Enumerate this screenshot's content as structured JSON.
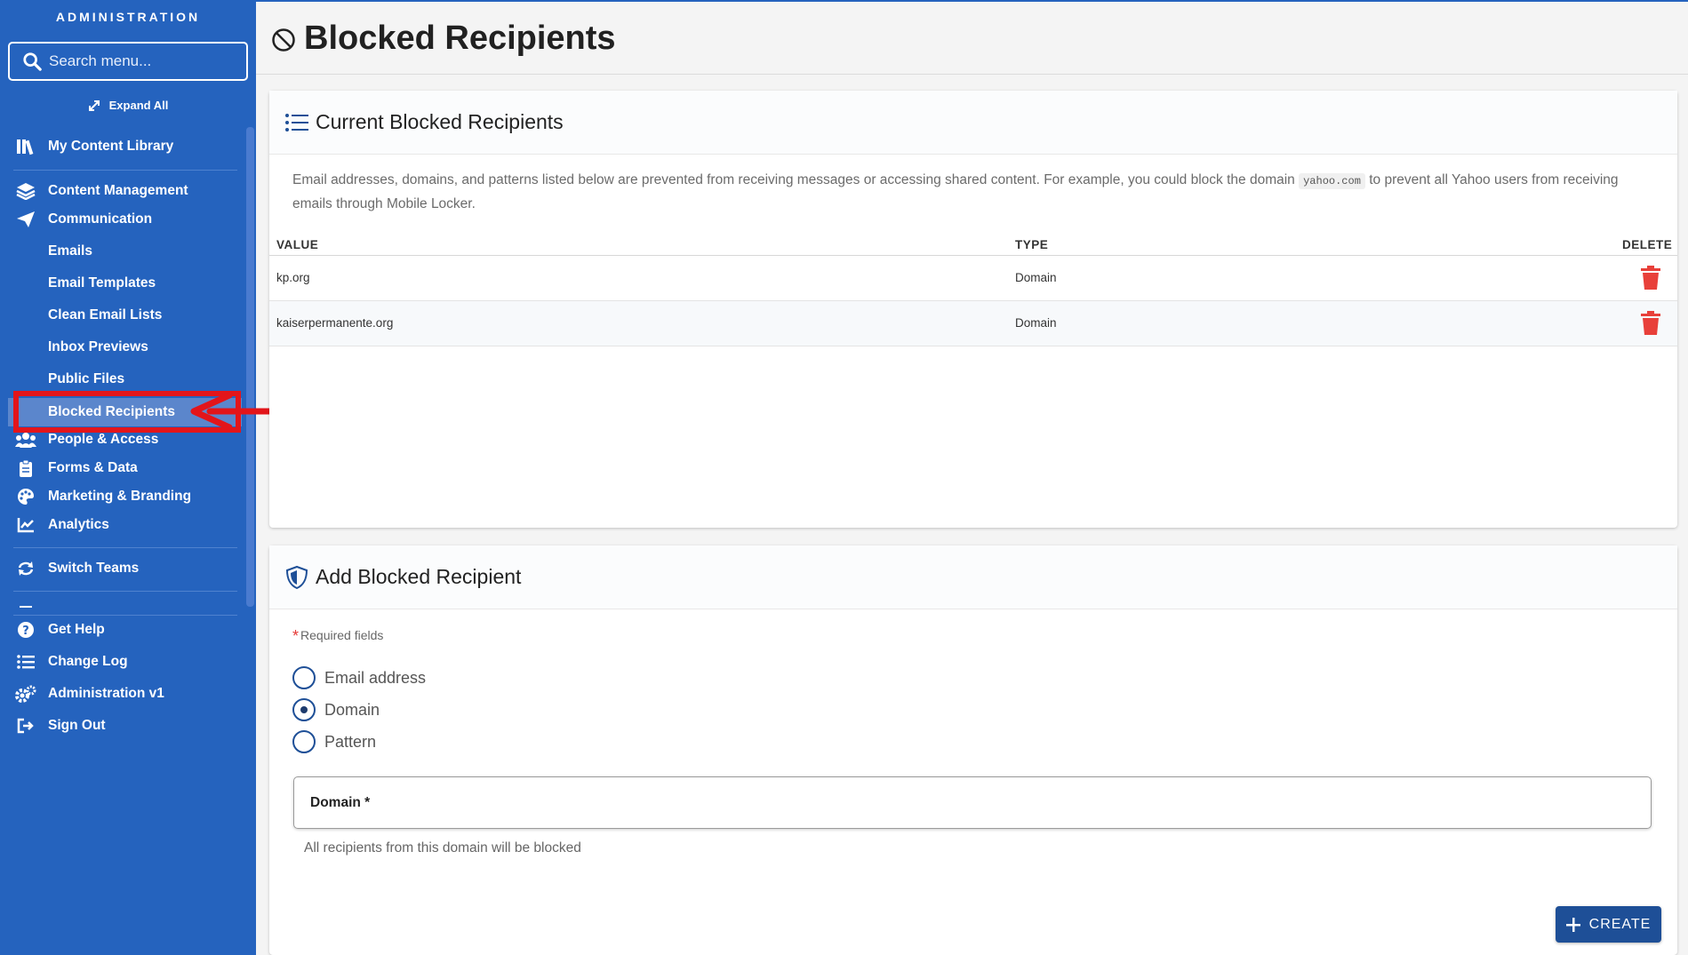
{
  "sidebar": {
    "title": "ADMINISTRATION",
    "search_placeholder": "Search menu...",
    "expand_all": "Expand All",
    "items": {
      "my_content_library": "My Content Library",
      "content_management": "Content Management",
      "communication": "Communication",
      "emails": "Emails",
      "email_templates": "Email Templates",
      "clean_email_lists": "Clean Email Lists",
      "inbox_previews": "Inbox Previews",
      "public_files": "Public Files",
      "blocked_recipients": "Blocked Recipients",
      "people_access": "People & Access",
      "forms_data": "Forms & Data",
      "marketing_branding": "Marketing & Branding",
      "analytics": "Analytics",
      "switch_teams": "Switch Teams",
      "get_help": "Get Help",
      "change_log": "Change Log",
      "administration_v1": "Administration v1",
      "sign_out": "Sign Out"
    },
    "colors": {
      "background": "#2563be",
      "active": "#5b86cc",
      "annotation": "#e3151a"
    }
  },
  "page": {
    "title": "Blocked Recipients"
  },
  "current_card": {
    "title": "Current Blocked Recipients",
    "desc_before": "Email addresses, domains, and patterns listed below are prevented from receiving messages or accessing shared content. For example, you could block the domain ",
    "desc_code": "yahoo.com",
    "desc_after": " to prevent all Yahoo users from receiving emails through Mobile Locker.",
    "columns": {
      "value": "VALUE",
      "type": "TYPE",
      "delete": "DELETE"
    },
    "rows": [
      {
        "value": "kp.org",
        "type": "Domain"
      },
      {
        "value": "kaiserpermanente.org",
        "type": "Domain"
      }
    ]
  },
  "add_card": {
    "title": "Add Blocked Recipient",
    "required_note": "Required fields",
    "options": [
      "Email address",
      "Domain",
      "Pattern"
    ],
    "selected_option": "Domain",
    "field_label": "Domain *",
    "field_value": "",
    "hint": "All recipients from this domain will be blocked",
    "create_label": "CREATE"
  }
}
